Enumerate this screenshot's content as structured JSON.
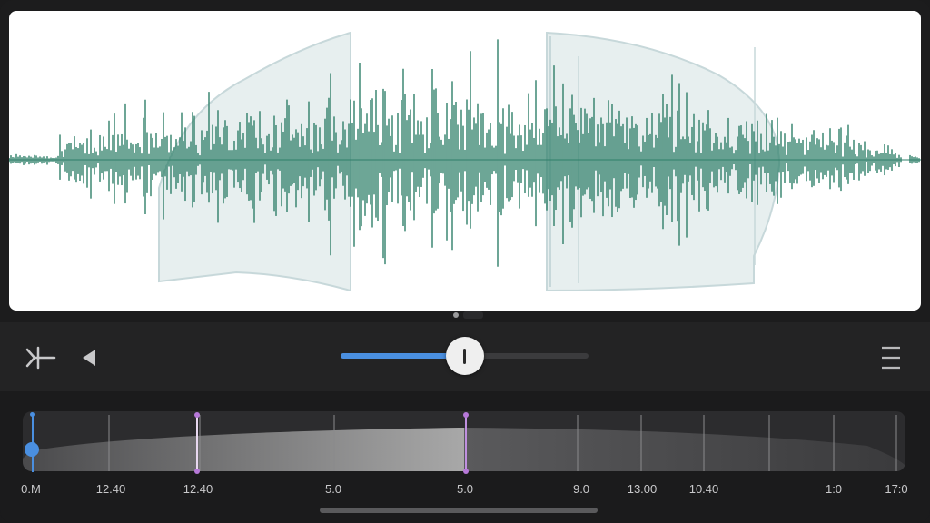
{
  "colors": {
    "waveform": "#2f7f69",
    "accent": "#4a8fe0",
    "marker": "#b678d8",
    "panel": "#ffffff",
    "background": "#1c1c1d"
  },
  "toolbar": {
    "trim_icon": "split-trim-icon",
    "back_icon": "play-reverse-icon",
    "menu_icon": "menu-icon",
    "position_fraction": 0.5
  },
  "timeline": {
    "playhead_fraction": 0.01,
    "labels": [
      "0.M",
      "12.40",
      "12.40",
      "5.0",
      "5.0",
      "9.0",
      "13.00",
      "10.40",
      "1:0",
      "17:0"
    ]
  }
}
